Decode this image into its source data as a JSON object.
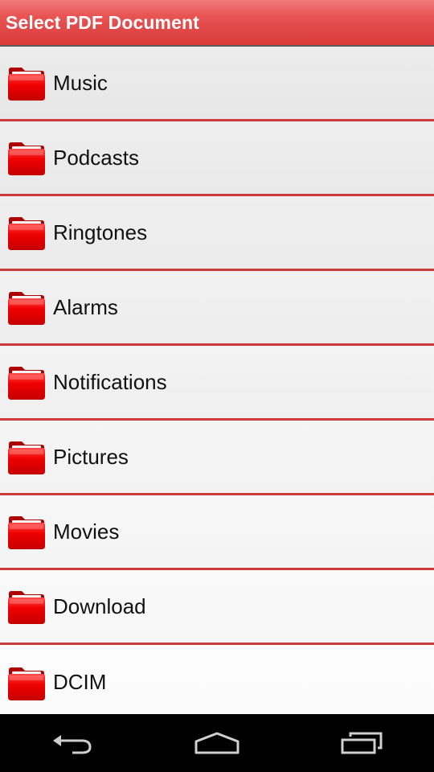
{
  "header": {
    "title": "Select PDF Document"
  },
  "colors": {
    "accent": "#d93a3a",
    "divider": "#cc3b3b",
    "folder": "#e60000"
  },
  "folders": [
    {
      "label": "Music",
      "icon": "folder-icon"
    },
    {
      "label": "Podcasts",
      "icon": "folder-icon"
    },
    {
      "label": "Ringtones",
      "icon": "folder-icon"
    },
    {
      "label": "Alarms",
      "icon": "folder-icon"
    },
    {
      "label": "Notifications",
      "icon": "folder-icon"
    },
    {
      "label": "Pictures",
      "icon": "folder-icon"
    },
    {
      "label": "Movies",
      "icon": "folder-icon"
    },
    {
      "label": "Download",
      "icon": "folder-icon"
    },
    {
      "label": "DCIM",
      "icon": "folder-icon"
    }
  ],
  "navigation": {
    "back": "back-icon",
    "home": "home-icon",
    "recents": "recent-apps-icon"
  }
}
